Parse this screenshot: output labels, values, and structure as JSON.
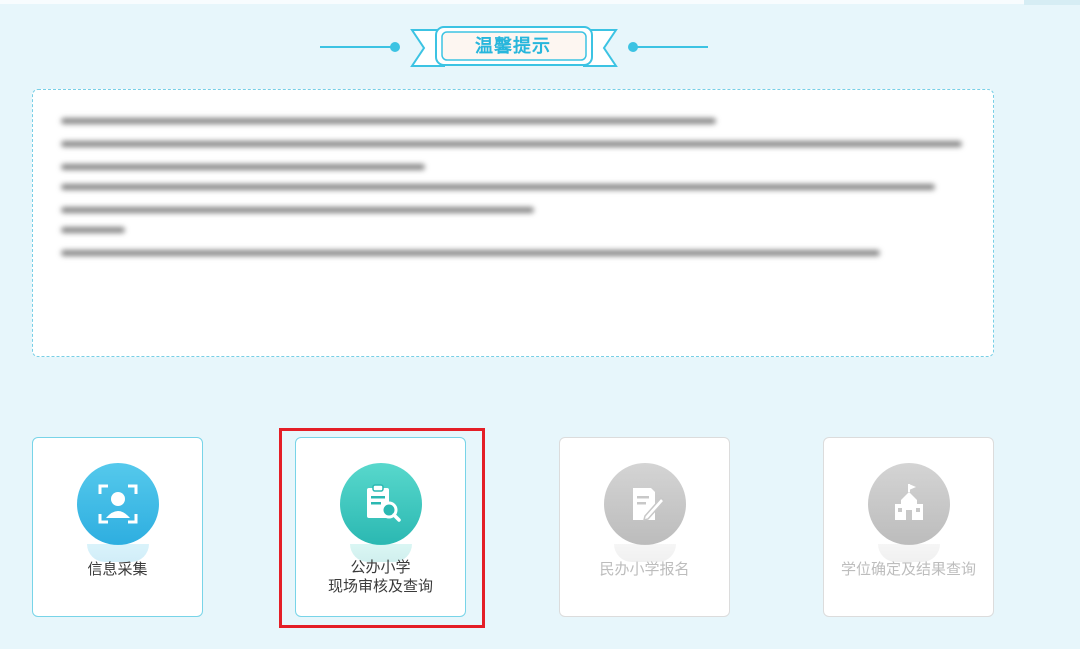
{
  "notice": {
    "title": "温馨提示"
  },
  "cards": [
    {
      "label": "信息采集",
      "icon": "face-scan-icon",
      "state": "active"
    },
    {
      "label_line1": "公办小学",
      "label_line2": "现场审核及查询",
      "icon": "document-search-icon",
      "state": "active"
    },
    {
      "label": "民办小学报名",
      "icon": "edit-form-icon",
      "state": "disabled"
    },
    {
      "label": "学位确定及结果查询",
      "icon": "school-icon",
      "state": "disabled"
    }
  ],
  "colors": {
    "accent": "#3cc3e3",
    "icon_blue": "#2eaee0",
    "icon_teal": "#2bb8b2",
    "disabled_gray": "#bcbcbc",
    "highlight_red": "#e41e26"
  }
}
